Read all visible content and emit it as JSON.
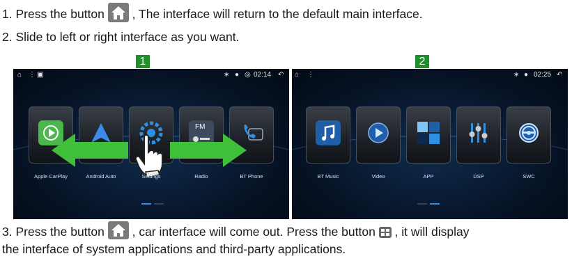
{
  "instructions": {
    "step1_before": "1. Press the button ",
    "step1_after": " ,  The interface will return to the default main interface.",
    "step2": "2. Slide to left or right interface as you want.",
    "step3_a": "3. Press the button ",
    "step3_b": " ,  car interface will come out. Press the button ",
    "step3_c": " ,  it will display",
    "step3_d": "the interface of system applications and third-party applications."
  },
  "screen1": {
    "marker": "1",
    "time": "02:14",
    "apps": [
      "Apple CarPlay",
      "Android Auto",
      "Settings",
      "Radio",
      "BT Phone"
    ],
    "radio_tile_text": "FM"
  },
  "screen2": {
    "marker": "2",
    "time": "02:25",
    "apps": [
      "BT Music",
      "Video",
      "APP",
      "DSP",
      "SWC"
    ]
  },
  "colors": {
    "marker_green": "#1f8f2c",
    "arrow_green": "#3fbf3a",
    "label_blue": "#cfe2ff"
  }
}
